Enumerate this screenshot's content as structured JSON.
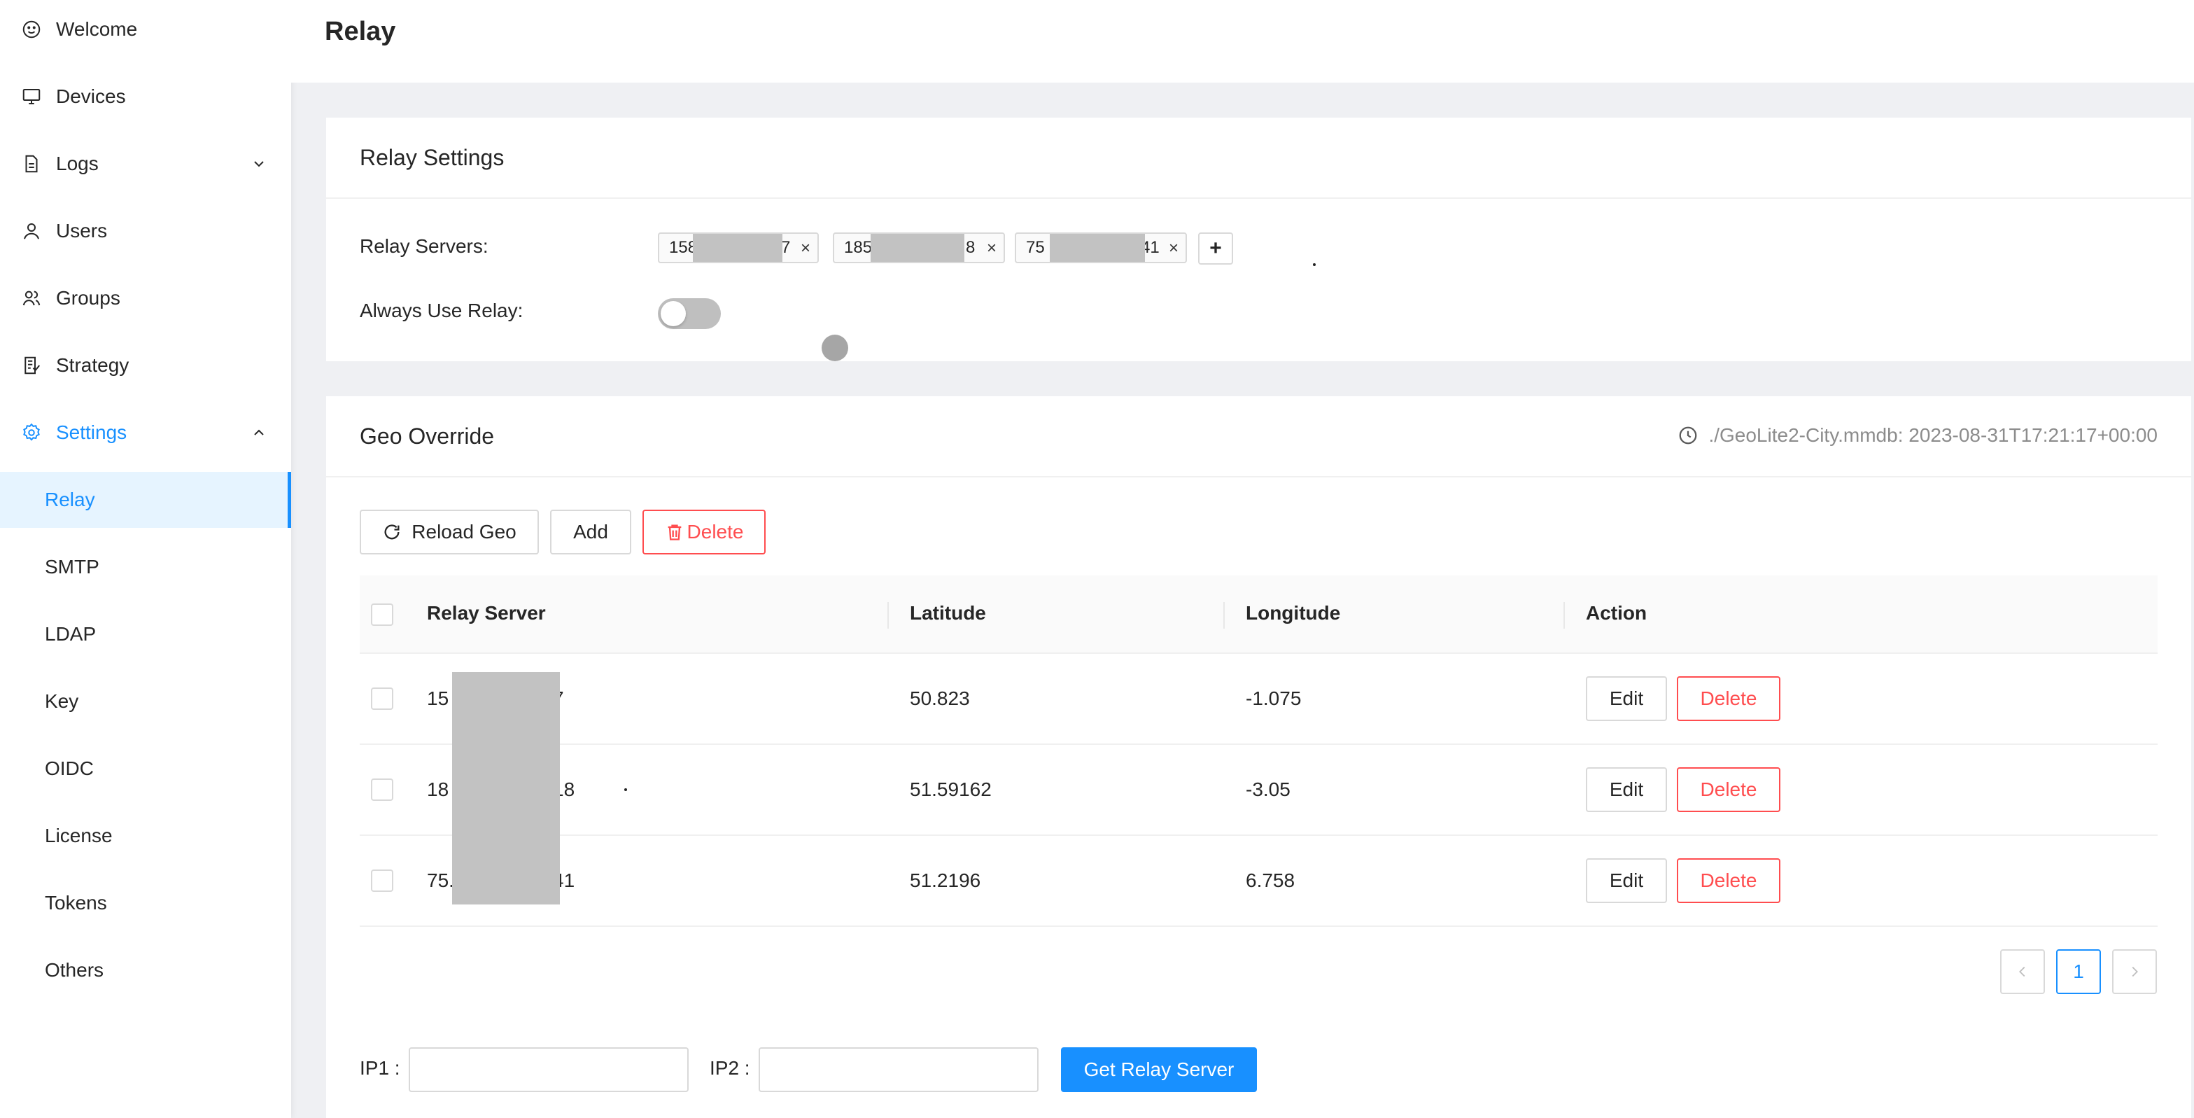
{
  "sidebar": {
    "items": [
      {
        "label": "Welcome",
        "icon": "smile-icon"
      },
      {
        "label": "Devices",
        "icon": "desktop-icon"
      },
      {
        "label": "Logs",
        "icon": "file-icon"
      },
      {
        "label": "Users",
        "icon": "user-icon"
      },
      {
        "label": "Groups",
        "icon": "team-icon"
      },
      {
        "label": "Strategy",
        "icon": "strategy-icon"
      },
      {
        "label": "Settings",
        "icon": "gear-icon"
      }
    ],
    "sub_items": [
      "Relay",
      "SMTP",
      "LDAP",
      "Key",
      "OIDC",
      "License",
      "Tokens",
      "Others"
    ],
    "selected_sub": "Relay",
    "accent_color": "#1890ff"
  },
  "header": {
    "title": "Relay"
  },
  "relay_settings": {
    "title": "Relay Settings",
    "servers_label": "Relay Servers:",
    "servers": [
      {
        "visible_start": "158",
        "visible_end": "7"
      },
      {
        "visible_start": "185",
        "visible_end": "8"
      },
      {
        "visible_start": "75",
        "visible_end": "41"
      }
    ],
    "add_label": "+",
    "always_relay_label": "Always Use Relay:",
    "always_relay_enabled": false
  },
  "geo_override": {
    "title": "Geo Override",
    "db_info": "./GeoLite2-City.mmdb: 2023-08-31T17:21:17+00:00",
    "reload_label": "Reload Geo",
    "add_label": "Add",
    "delete_label": "Delete",
    "columns": [
      "Relay Server",
      "Latitude",
      "Longitude",
      "Action"
    ],
    "rows": [
      {
        "server_start": "15",
        "server_end": "7",
        "latitude": "50.823",
        "longitude": "-1.075"
      },
      {
        "server_start": "18",
        "server_end": "18",
        "latitude": "51.59162",
        "longitude": "-3.05"
      },
      {
        "server_start": "75.",
        "server_end": "41",
        "latitude": "51.2196",
        "longitude": "6.758"
      }
    ],
    "edit_label": "Edit",
    "row_delete_label": "Delete",
    "pagination": {
      "current_page": "1"
    },
    "ip1_label": "IP1 :",
    "ip2_label": "IP2 :",
    "ip1_value": "",
    "ip2_value": "",
    "get_relay_label": "Get Relay Server"
  }
}
